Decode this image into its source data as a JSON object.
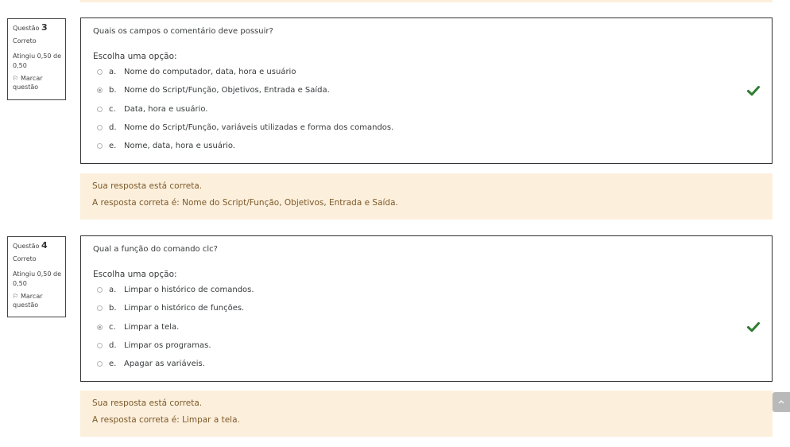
{
  "questions": [
    {
      "label": "Questão",
      "number": "3",
      "state": "Correto",
      "grade": "Atingiu 0,50 de 0,50",
      "flag_label": "Marcar questão",
      "question_text": "Quais os campos o comentário deve possuir?",
      "prompt": "Escolha uma opção:",
      "options": [
        {
          "letter": "a.",
          "text": "Nome do computador, data, hora e usuário",
          "selected": false
        },
        {
          "letter": "b.",
          "text": "Nome do Script/Função, Objetivos, Entrada e Saída.",
          "selected": true
        },
        {
          "letter": "c.",
          "text": "Data, hora e usuário.",
          "selected": false
        },
        {
          "letter": "d.",
          "text": "Nome do Script/Função, variáveis utilizadas e forma dos comandos.",
          "selected": false
        },
        {
          "letter": "e.",
          "text": "Nome, data, hora e usuário.",
          "selected": false
        }
      ],
      "feedback_status": "Sua resposta está correta.",
      "correct_answer": "A resposta correta é: Nome do Script/Função, Objetivos, Entrada e Saída."
    },
    {
      "label": "Questão",
      "number": "4",
      "state": "Correto",
      "grade": "Atingiu 0,50 de 0,50",
      "flag_label": "Marcar questão",
      "question_text": "Qual a função do comando clc?",
      "prompt": "Escolha uma opção:",
      "options": [
        {
          "letter": "a.",
          "text": "Limpar o histórico de comandos.",
          "selected": false
        },
        {
          "letter": "b.",
          "text": "Limpar o histórico de funções.",
          "selected": false
        },
        {
          "letter": "c.",
          "text": "Limpar a tela.",
          "selected": true
        },
        {
          "letter": "d.",
          "text": "Limpar os programas.",
          "selected": false
        },
        {
          "letter": "e.",
          "text": "Apagar as variáveis.",
          "selected": false
        }
      ],
      "feedback_status": "Sua resposta está correta.",
      "correct_answer": "A resposta correta é: Limpar a tela."
    }
  ],
  "colors": {
    "feedback_bg": "#fcefdc",
    "feedback_text": "#7d5a29",
    "correct_check": "#2e7d32"
  },
  "icons": {
    "flag": "flag-icon",
    "correct": "check-icon",
    "back_to_top": "chevron-up-icon"
  }
}
